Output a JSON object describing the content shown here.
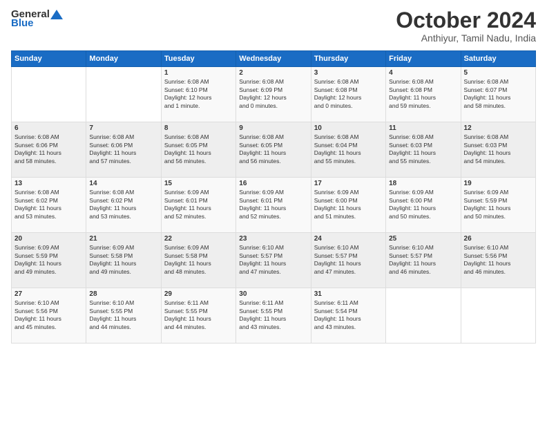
{
  "logo": {
    "general": "General",
    "blue": "Blue"
  },
  "title": "October 2024",
  "location": "Anthiyur, Tamil Nadu, India",
  "days_header": [
    "Sunday",
    "Monday",
    "Tuesday",
    "Wednesday",
    "Thursday",
    "Friday",
    "Saturday"
  ],
  "weeks": [
    [
      {
        "day": "",
        "info": ""
      },
      {
        "day": "",
        "info": ""
      },
      {
        "day": "1",
        "info": "Sunrise: 6:08 AM\nSunset: 6:10 PM\nDaylight: 12 hours\nand 1 minute."
      },
      {
        "day": "2",
        "info": "Sunrise: 6:08 AM\nSunset: 6:09 PM\nDaylight: 12 hours\nand 0 minutes."
      },
      {
        "day": "3",
        "info": "Sunrise: 6:08 AM\nSunset: 6:08 PM\nDaylight: 12 hours\nand 0 minutes."
      },
      {
        "day": "4",
        "info": "Sunrise: 6:08 AM\nSunset: 6:08 PM\nDaylight: 11 hours\nand 59 minutes."
      },
      {
        "day": "5",
        "info": "Sunrise: 6:08 AM\nSunset: 6:07 PM\nDaylight: 11 hours\nand 58 minutes."
      }
    ],
    [
      {
        "day": "6",
        "info": "Sunrise: 6:08 AM\nSunset: 6:06 PM\nDaylight: 11 hours\nand 58 minutes."
      },
      {
        "day": "7",
        "info": "Sunrise: 6:08 AM\nSunset: 6:06 PM\nDaylight: 11 hours\nand 57 minutes."
      },
      {
        "day": "8",
        "info": "Sunrise: 6:08 AM\nSunset: 6:05 PM\nDaylight: 11 hours\nand 56 minutes."
      },
      {
        "day": "9",
        "info": "Sunrise: 6:08 AM\nSunset: 6:05 PM\nDaylight: 11 hours\nand 56 minutes."
      },
      {
        "day": "10",
        "info": "Sunrise: 6:08 AM\nSunset: 6:04 PM\nDaylight: 11 hours\nand 55 minutes."
      },
      {
        "day": "11",
        "info": "Sunrise: 6:08 AM\nSunset: 6:03 PM\nDaylight: 11 hours\nand 55 minutes."
      },
      {
        "day": "12",
        "info": "Sunrise: 6:08 AM\nSunset: 6:03 PM\nDaylight: 11 hours\nand 54 minutes."
      }
    ],
    [
      {
        "day": "13",
        "info": "Sunrise: 6:08 AM\nSunset: 6:02 PM\nDaylight: 11 hours\nand 53 minutes."
      },
      {
        "day": "14",
        "info": "Sunrise: 6:08 AM\nSunset: 6:02 PM\nDaylight: 11 hours\nand 53 minutes."
      },
      {
        "day": "15",
        "info": "Sunrise: 6:09 AM\nSunset: 6:01 PM\nDaylight: 11 hours\nand 52 minutes."
      },
      {
        "day": "16",
        "info": "Sunrise: 6:09 AM\nSunset: 6:01 PM\nDaylight: 11 hours\nand 52 minutes."
      },
      {
        "day": "17",
        "info": "Sunrise: 6:09 AM\nSunset: 6:00 PM\nDaylight: 11 hours\nand 51 minutes."
      },
      {
        "day": "18",
        "info": "Sunrise: 6:09 AM\nSunset: 6:00 PM\nDaylight: 11 hours\nand 50 minutes."
      },
      {
        "day": "19",
        "info": "Sunrise: 6:09 AM\nSunset: 5:59 PM\nDaylight: 11 hours\nand 50 minutes."
      }
    ],
    [
      {
        "day": "20",
        "info": "Sunrise: 6:09 AM\nSunset: 5:59 PM\nDaylight: 11 hours\nand 49 minutes."
      },
      {
        "day": "21",
        "info": "Sunrise: 6:09 AM\nSunset: 5:58 PM\nDaylight: 11 hours\nand 49 minutes."
      },
      {
        "day": "22",
        "info": "Sunrise: 6:09 AM\nSunset: 5:58 PM\nDaylight: 11 hours\nand 48 minutes."
      },
      {
        "day": "23",
        "info": "Sunrise: 6:10 AM\nSunset: 5:57 PM\nDaylight: 11 hours\nand 47 minutes."
      },
      {
        "day": "24",
        "info": "Sunrise: 6:10 AM\nSunset: 5:57 PM\nDaylight: 11 hours\nand 47 minutes."
      },
      {
        "day": "25",
        "info": "Sunrise: 6:10 AM\nSunset: 5:57 PM\nDaylight: 11 hours\nand 46 minutes."
      },
      {
        "day": "26",
        "info": "Sunrise: 6:10 AM\nSunset: 5:56 PM\nDaylight: 11 hours\nand 46 minutes."
      }
    ],
    [
      {
        "day": "27",
        "info": "Sunrise: 6:10 AM\nSunset: 5:56 PM\nDaylight: 11 hours\nand 45 minutes."
      },
      {
        "day": "28",
        "info": "Sunrise: 6:10 AM\nSunset: 5:55 PM\nDaylight: 11 hours\nand 44 minutes."
      },
      {
        "day": "29",
        "info": "Sunrise: 6:11 AM\nSunset: 5:55 PM\nDaylight: 11 hours\nand 44 minutes."
      },
      {
        "day": "30",
        "info": "Sunrise: 6:11 AM\nSunset: 5:55 PM\nDaylight: 11 hours\nand 43 minutes."
      },
      {
        "day": "31",
        "info": "Sunrise: 6:11 AM\nSunset: 5:54 PM\nDaylight: 11 hours\nand 43 minutes."
      },
      {
        "day": "",
        "info": ""
      },
      {
        "day": "",
        "info": ""
      }
    ]
  ]
}
